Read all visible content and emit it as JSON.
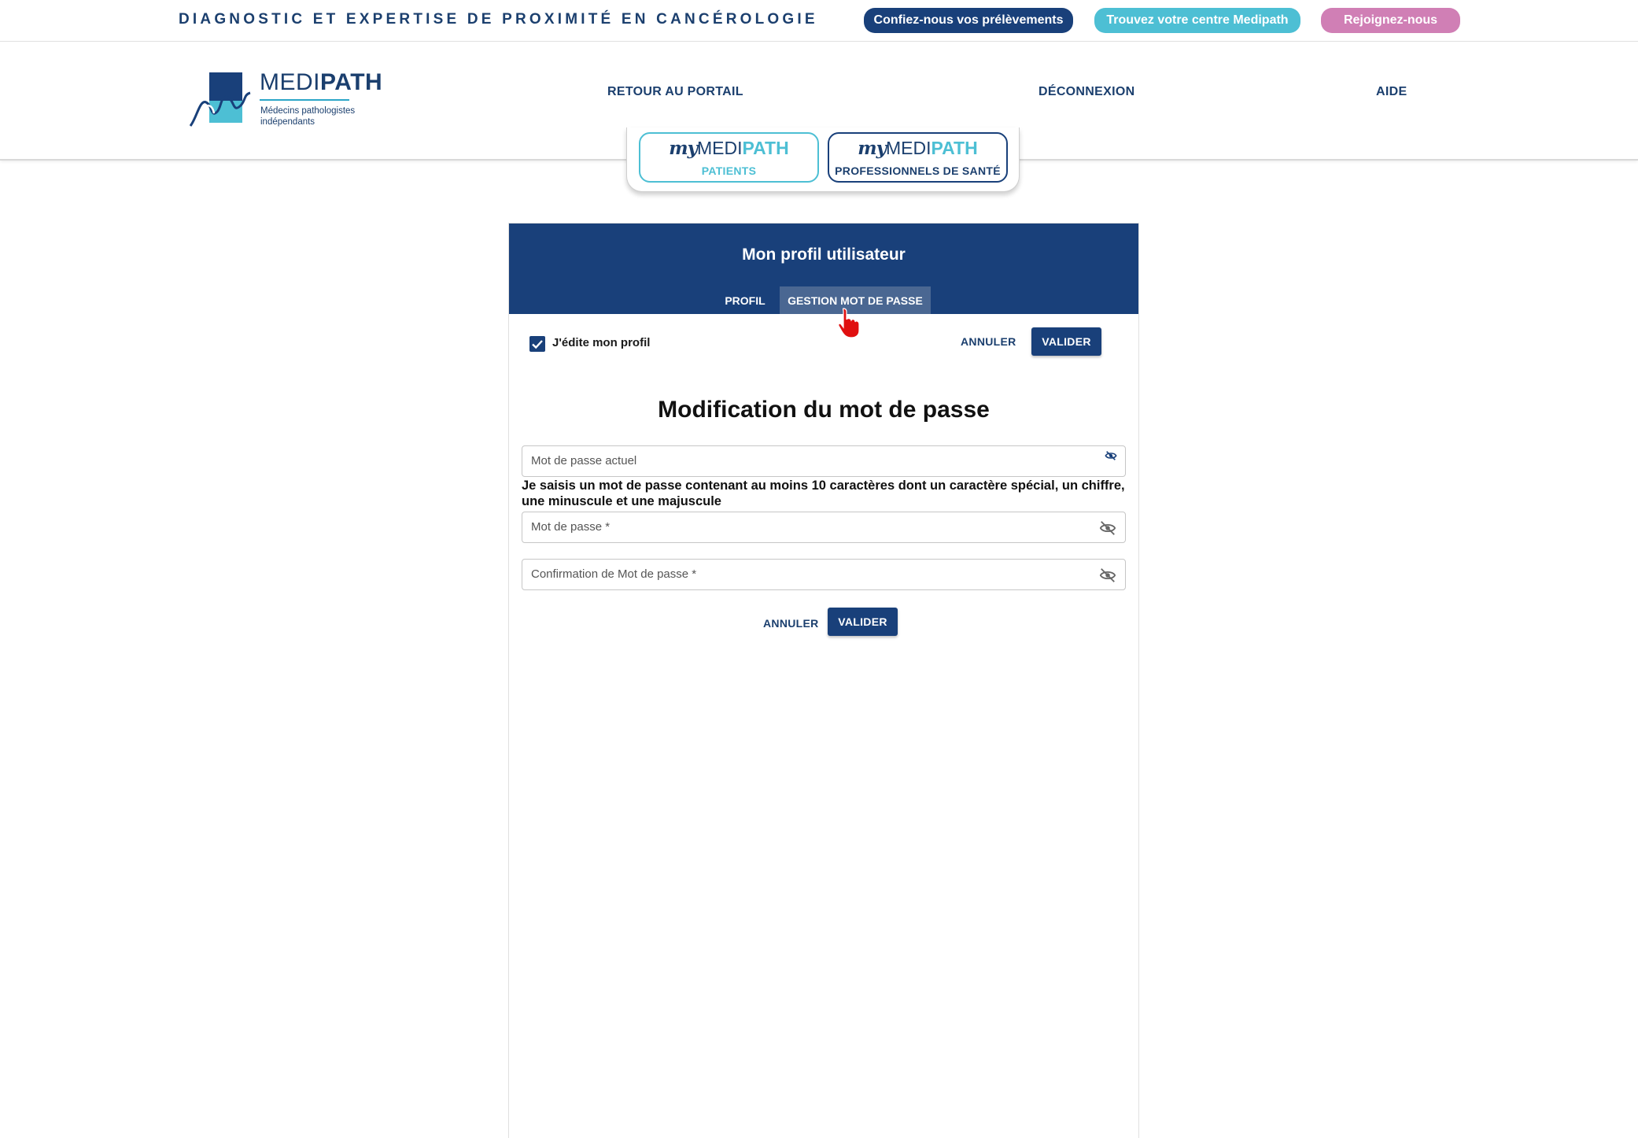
{
  "topbar": {
    "tagline": "DIAGNOSTIC ET EXPERTISE DE PROXIMITÉ EN CANCÉROLOGIE",
    "pill_samples": "Confiez-nous vos prélèvements",
    "pill_center": "Trouvez votre centre Medipath",
    "pill_join": "Rejoignez-nous"
  },
  "logo": {
    "name_light": "MEDI",
    "name_bold": "PATH",
    "subtitle": "Médecins pathologistes indépendants"
  },
  "nav": {
    "portal": "RETOUR AU PORTAIL",
    "logout": "DÉCONNEXION",
    "help": "AIDE"
  },
  "switcher": {
    "logo_my": "my",
    "logo_medi": "MEDI",
    "logo_path": "PATH",
    "patients": "PATIENTS",
    "pros": "PROFESSIONNELS DE SANTÉ"
  },
  "card": {
    "title": "Mon profil utilisateur",
    "tabs": [
      "PROFIL",
      "GESTION MOT DE PASSE"
    ],
    "active_tab": "GESTION MOT DE PASSE",
    "edit_label": "J'édite mon profil",
    "edit_checked": true,
    "cancel": "ANNULER",
    "validate": "VALIDER"
  },
  "password_form": {
    "title": "Modification du mot de passe",
    "current_placeholder": "Mot de passe actuel",
    "hint": "Je saisis un mot de passe contenant au moins 10 caractères dont un caractère spécial, un chiffre, une minuscule et une majuscule",
    "new_placeholder": "Mot de passe *",
    "confirm_placeholder": "Confirmation de Mot de passe *",
    "cancel": "ANNULER",
    "validate": "VALIDER"
  },
  "colors": {
    "navy": "#19407a",
    "cyan": "#4dbfd4",
    "pink": "#d07fb5",
    "tab_active": "#4a6792"
  },
  "icons": [
    "eye-off-icon",
    "check-icon",
    "hand-pointer-icon"
  ]
}
